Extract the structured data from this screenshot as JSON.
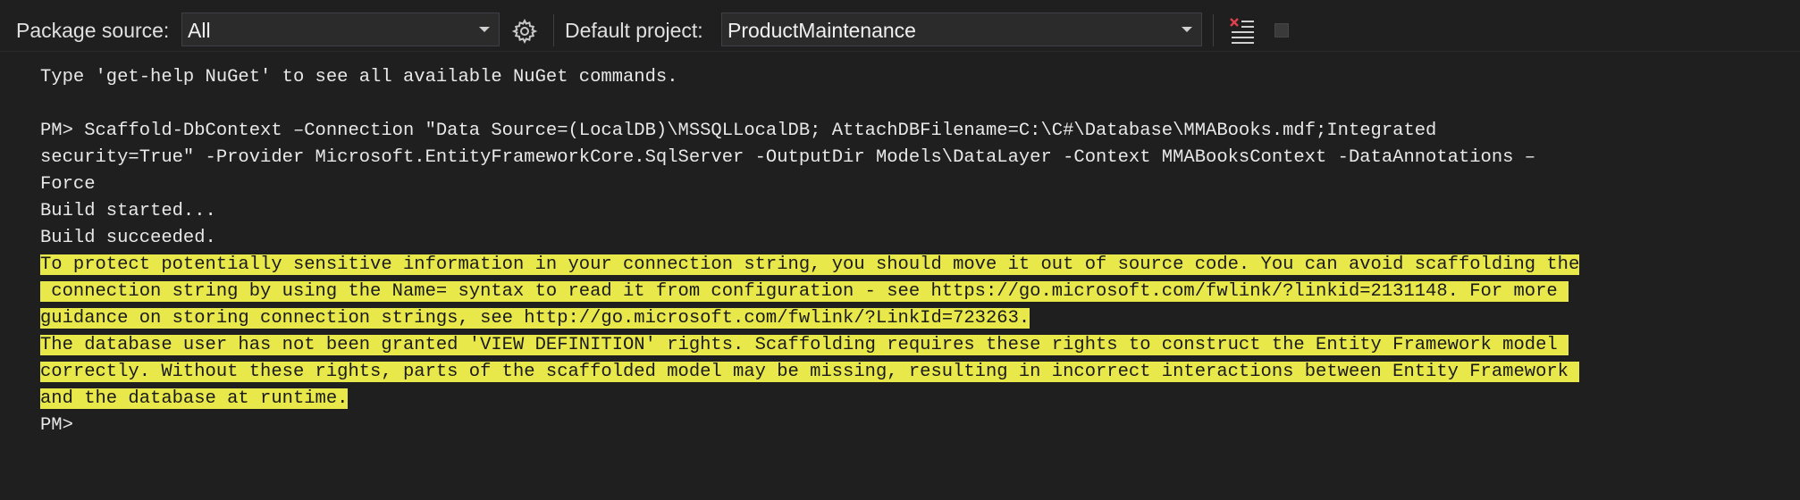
{
  "toolbar": {
    "package_source_label": "Package source:",
    "package_source_value": "All",
    "default_project_label": "Default project:",
    "default_project_value": "ProductMaintenance",
    "settings_icon": "gear-icon",
    "clear_icon": "clear-console-icon",
    "stop_icon": "stop-icon"
  },
  "console": {
    "lines": [
      "Type 'get-help NuGet' to see all available NuGet commands.",
      "",
      "PM> Scaffold-DbContext –Connection \"Data Source=(LocalDB)\\MSSQLLocalDB; AttachDBFilename=C:\\C#\\Database\\MMABooks.mdf;Integrated",
      "security=True\" -Provider Microsoft.EntityFrameworkCore.SqlServer -OutputDir Models\\DataLayer -Context MMABooksContext -DataAnnotations –",
      "Force",
      "Build started...",
      "Build succeeded."
    ],
    "warnings": [
      "To protect potentially sensitive information in your connection string, you should move it out of source code. You can avoid scaffolding the",
      " connection string by using the Name= syntax to read it from configuration - see https://go.microsoft.com/fwlink/?linkid=2131148. For more ",
      "guidance on storing connection strings, see http://go.microsoft.com/fwlink/?LinkId=723263.",
      "The database user has not been granted 'VIEW DEFINITION' rights. Scaffolding requires these rights to construct the Entity Framework model ",
      "correctly. Without these rights, parts of the scaffolded model may be missing, resulting in incorrect interactions between Entity Framework ",
      "and the database at runtime."
    ],
    "prompt": "PM>"
  },
  "colors": {
    "background": "#1f1f1f",
    "text": "#e8e8e8",
    "warning_highlight": "#e8e84a",
    "warning_text": "#1a1a1a"
  }
}
